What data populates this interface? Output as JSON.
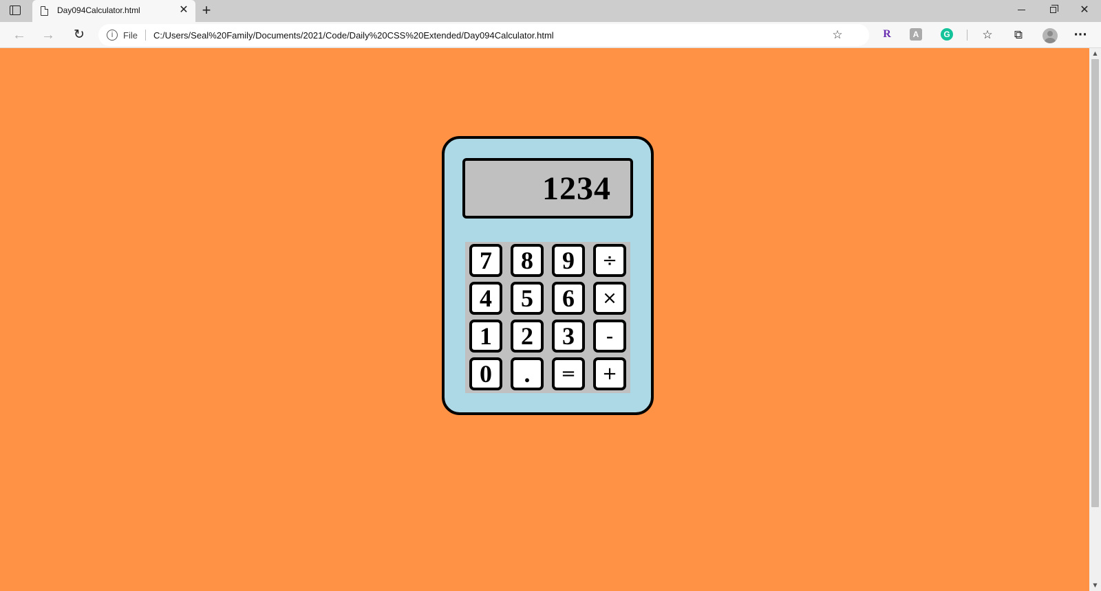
{
  "browser": {
    "tab_title": "Day094Calculator.html",
    "tab_close": "✕",
    "new_tab": "+",
    "file_label": "File",
    "url": "C:/Users/Seal%20Family/Documents/2021/Code/Daily%20CSS%20Extended/Day094Calculator.html",
    "window_controls": {
      "close": "✕"
    },
    "nav": {
      "back": "←",
      "forward": "→",
      "reload": "↻"
    },
    "icons": {
      "info": "i",
      "add_favorite": "☆",
      "ext_r": "R",
      "ext_gray": "A",
      "ext_g": "G",
      "favorites": "☆",
      "collections": "⧉",
      "more": "···"
    }
  },
  "page": {
    "background_color": "#ff9244",
    "calculator": {
      "body_color": "#add8e6",
      "display_color": "#c0c0c0",
      "display_value": "1234",
      "keys": [
        {
          "label": "7",
          "name": "key-7"
        },
        {
          "label": "8",
          "name": "key-8"
        },
        {
          "label": "9",
          "name": "key-9"
        },
        {
          "label": "÷",
          "name": "key-divide"
        },
        {
          "label": "4",
          "name": "key-4"
        },
        {
          "label": "5",
          "name": "key-5"
        },
        {
          "label": "6",
          "name": "key-6"
        },
        {
          "label": "×",
          "name": "key-multiply"
        },
        {
          "label": "1",
          "name": "key-1"
        },
        {
          "label": "2",
          "name": "key-2"
        },
        {
          "label": "3",
          "name": "key-3"
        },
        {
          "label": "-",
          "name": "key-minus"
        },
        {
          "label": "0",
          "name": "key-0"
        },
        {
          "label": ".",
          "name": "key-decimal"
        },
        {
          "label": "=",
          "name": "key-equals"
        },
        {
          "label": "+",
          "name": "key-plus"
        }
      ]
    }
  }
}
